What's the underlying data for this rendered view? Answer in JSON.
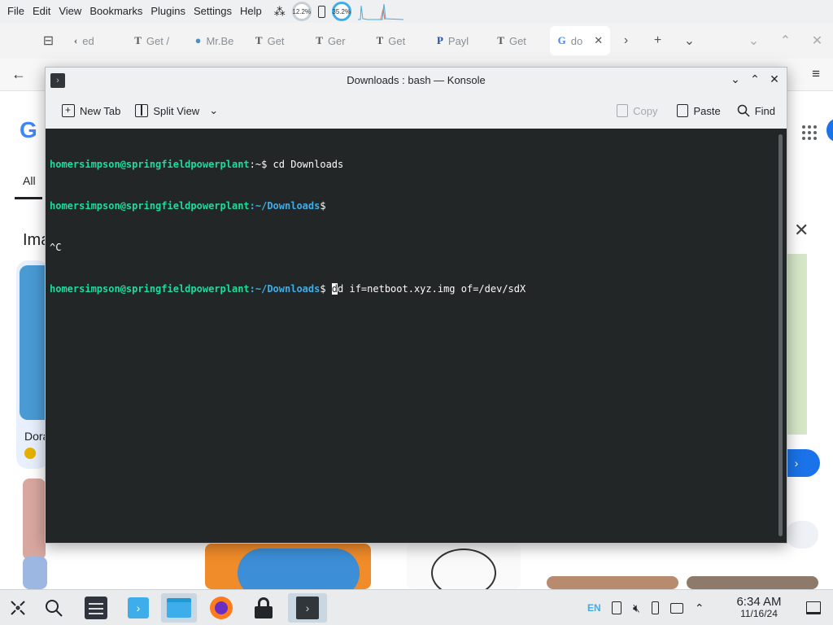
{
  "browser": {
    "menu": [
      "File",
      "Edit",
      "View",
      "Bookmarks",
      "Plugins",
      "Settings",
      "Help"
    ],
    "monitor": {
      "gauge1": "12.2%",
      "gauge2": "35.2%"
    },
    "tabs": [
      {
        "glyph": "‹",
        "label": "ed"
      },
      {
        "glyph": "T",
        "label": "Get /"
      },
      {
        "glyph": "●",
        "label": "Mr.Be"
      },
      {
        "glyph": "T",
        "label": "Get"
      },
      {
        "glyph": "T",
        "label": "Ger"
      },
      {
        "glyph": "T",
        "label": "Get"
      },
      {
        "glyph": "P",
        "label": "Payl"
      },
      {
        "glyph": "T",
        "label": "Get"
      },
      {
        "glyph": "G",
        "label": "do"
      }
    ],
    "content": {
      "all_filter": "All",
      "section": "Ima",
      "card_caption": "Dora"
    }
  },
  "konsole": {
    "title": "Downloads : bash — Konsole",
    "toolbar": {
      "new_tab": "New Tab",
      "split_view": "Split View",
      "copy": "Copy",
      "paste": "Paste",
      "find": "Find"
    },
    "terminal": {
      "user": "homersimpson@springfieldpowerplant",
      "line1_path": ":~",
      "line1_cmd": "$ cd Downloads",
      "line2_path": ":~/Downloads",
      "line2_cmd": "$",
      "line3": "^C",
      "line4_path": ":~/Downloads",
      "line4_prompt": "$ ",
      "line4_cursor_char": "d",
      "line4_cmd": "d if=netboot.xyz.img of=/dev/sdX"
    }
  },
  "taskbar": {
    "lang": "EN",
    "time": "6:34 AM",
    "date": "11/16/24"
  },
  "colors": {
    "terminal_bg": "#232627",
    "user": "#1cdc9a",
    "path": "#3daee9",
    "accent": "#3daee9"
  }
}
